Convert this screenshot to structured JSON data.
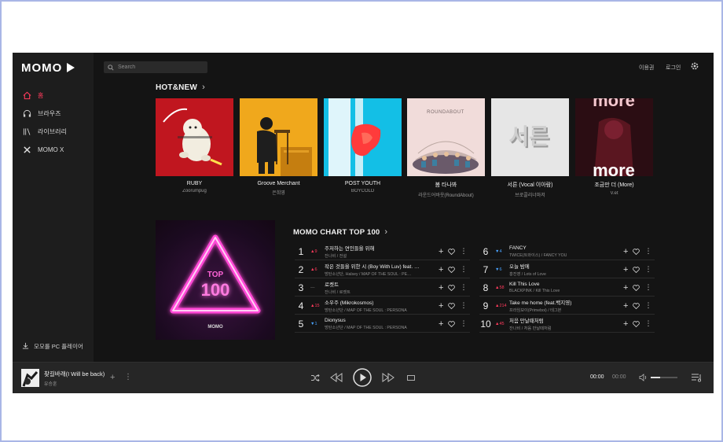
{
  "sidebar": {
    "logo": "MOMO",
    "items": [
      {
        "label": "홈",
        "icon": "home-icon",
        "active": true
      },
      {
        "label": "브라우즈",
        "icon": "headphones-icon",
        "active": false
      },
      {
        "label": "라이브러리",
        "icon": "library-icon",
        "active": false
      },
      {
        "label": "MOMO X",
        "icon": "x-icon",
        "active": false
      }
    ],
    "download_label": "모모를 PC 플레이어"
  },
  "header": {
    "search_placeholder": "Search",
    "pass_label": "이용권",
    "login_label": "로그인"
  },
  "hot_new": {
    "title": "HOT&NEW",
    "albums": [
      {
        "title": "RUBY",
        "artist": "Zoorumpug"
      },
      {
        "title": "Groove Merchant",
        "artist": "은희영"
      },
      {
        "title": "POST YOUTH",
        "artist": "BOYCOLD"
      },
      {
        "title": "봄 타나봐",
        "artist": "라운드어바웃(RoundAbout)",
        "cover_text": "ROUNDABOUT"
      },
      {
        "title": "서른 (Vocal 이아람)",
        "artist": "브로콜리너마저",
        "cover_text": "서른"
      },
      {
        "title": "조금만 더 (More)",
        "artist": "V.et",
        "cover_text_top": "more",
        "cover_text_bottom": "more"
      }
    ]
  },
  "chart": {
    "title": "MOMO CHART TOP 100",
    "badge_top": "TOP",
    "badge_num": "100",
    "badge_logo": "MOMO",
    "rows": [
      {
        "rank": "1",
        "change": "▲9",
        "dir": "up",
        "title": "주저하는 연인들을 위해",
        "artist": "잔나비 / 전설"
      },
      {
        "rank": "2",
        "change": "▲6",
        "dir": "up",
        "title": "작은 것들을 위한 시 (Boy With Luv) feat. …",
        "artist": "방탄소년단, Halsey / MAP OF THE SOUL : PE…"
      },
      {
        "rank": "3",
        "change": "—",
        "dir": "same",
        "title": "로켓트",
        "artist": "잔나비 / 로켓트"
      },
      {
        "rank": "4",
        "change": "▲15",
        "dir": "up",
        "title": "소우주 (Mikrokosmos)",
        "artist": "방탄소년단 / MAP OF THE SOUL : PERSONA"
      },
      {
        "rank": "5",
        "change": "▼1",
        "dir": "down",
        "title": "Dionysus",
        "artist": "방탄소년단 / MAP OF THE SOUL : PERSONA"
      },
      {
        "rank": "6",
        "change": "▼4",
        "dir": "down",
        "title": "FANCY",
        "artist": "TWICE(트와이스) / FANCY YOU"
      },
      {
        "rank": "7",
        "change": "▼6",
        "dir": "down",
        "title": "오늘 밤에",
        "artist": "홍진영 / Lots of Love"
      },
      {
        "rank": "8",
        "change": "▲58",
        "dir": "up",
        "title": "Kill This Love",
        "artist": "BLACKPINK / Kill This Love"
      },
      {
        "rank": "9",
        "change": "▲214",
        "dir": "up",
        "title": "Take me home (feat.백지영)",
        "artist": "프라임보이(Primeboi) / 테그본"
      },
      {
        "rank": "10",
        "change": "▲45",
        "dir": "up",
        "title": "처음 만날때처럼",
        "artist": "잔나비 / 처음 만날때처럼"
      }
    ]
  },
  "player": {
    "title": "찾길바래(I Will be back)",
    "artist": "유승훈",
    "current_time": "00:00",
    "total_time": "00:00",
    "volume": 0.35
  }
}
